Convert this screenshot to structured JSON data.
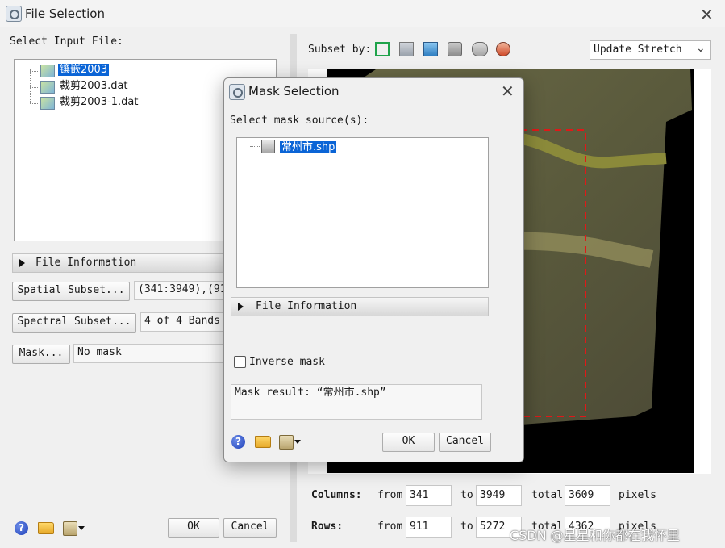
{
  "window": {
    "title": "File Selection",
    "close_icon": "close-icon"
  },
  "input": {
    "label": "Select Input File:",
    "files": [
      "镶嵌2003",
      "裁剪2003.dat",
      "裁剪2003-1.dat"
    ]
  },
  "file_info_label": "File Information",
  "spatial": {
    "button": "Spatial Subset...",
    "value": "(341:3949),(911"
  },
  "spectral": {
    "button": "Spectral Subset...",
    "value": "4 of 4 Bands"
  },
  "mask": {
    "button": "Mask...",
    "value": "No mask"
  },
  "bottom": {
    "ok": "OK",
    "cancel": "Cancel"
  },
  "subset": {
    "label": "Subset by:",
    "tool_icons": [
      "rectangle-subset-icon",
      "image-subset-icon",
      "map-subset-icon",
      "vector-subset-icon",
      "roi-subset-icon",
      "file-subset-icon"
    ],
    "stretch_selected": "Update Stretch"
  },
  "extent": {
    "columns_label": "Columns:",
    "rows_label": "Rows:",
    "from_label": "from",
    "to_label": "to",
    "total_label": "total",
    "units": "pixels",
    "columns": {
      "from": "341",
      "to": "3949",
      "total": "3609"
    },
    "rows": {
      "from": "911",
      "to": "5272",
      "total": "4362"
    }
  },
  "mask_dialog": {
    "title": "Mask Selection",
    "sources_label": "Select mask source(s):",
    "sources": [
      "常州市.shp"
    ],
    "file_info_label": "File Information",
    "inverse_label": "Inverse mask",
    "inverse_checked": false,
    "result_text": "Mask result: “常州市.shp”",
    "ok": "OK",
    "cancel": "Cancel"
  },
  "watermark": "CSDN @星星和你都在我怀里",
  "colors": {
    "selection": "#0a64d6",
    "subset_box": "#e01818",
    "image_tint": "#6f6a3a"
  }
}
